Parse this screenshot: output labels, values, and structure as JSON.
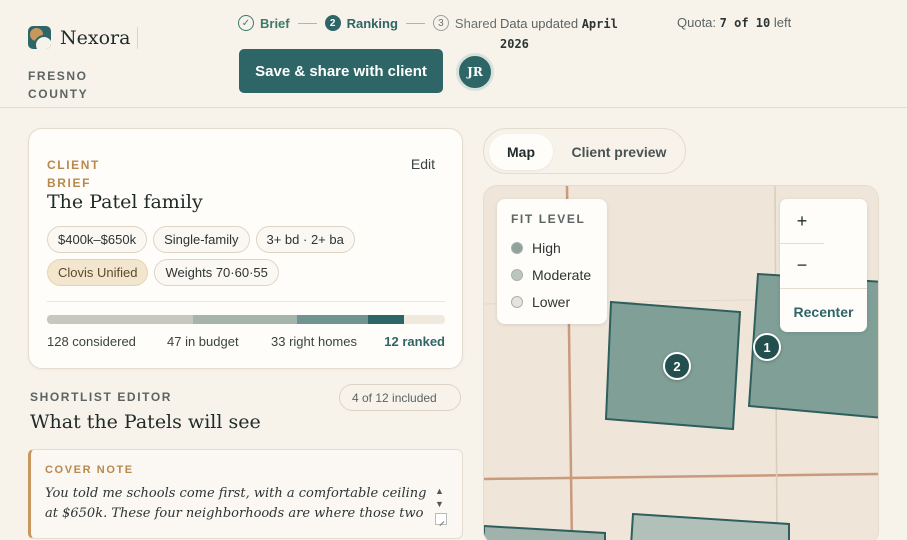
{
  "app": {
    "name": "Nexora",
    "region": "FRESNO COUNTY",
    "avatar_initials": "JR",
    "save_button": "Save & share with client"
  },
  "steps": [
    {
      "num": "✓",
      "label": "Brief",
      "state": "done"
    },
    {
      "num": "2",
      "label": "Ranking",
      "state": "active"
    },
    {
      "num": "3",
      "label": "Shared",
      "state": "todo"
    }
  ],
  "updated": {
    "prefix": "Data updated",
    "value": "April 2026"
  },
  "quota": {
    "prefix": "Quota:",
    "value": "7 of 10",
    "suffix": "left"
  },
  "brief": {
    "eyebrow": "CLIENT BRIEF",
    "edit_label": "Edit",
    "client_name": "The Patel family",
    "chips": [
      {
        "label": "$400k–$650k",
        "highlight": false
      },
      {
        "label": "Single-family",
        "highlight": false
      },
      {
        "label": "3+ bd · 2+ ba",
        "highlight": false
      },
      {
        "label": "Clovis Unified",
        "highlight": true
      },
      {
        "label": "Weights 70·60·55",
        "highlight": false
      }
    ],
    "funnel": [
      {
        "label": "128 considered",
        "count": 128,
        "color": "#c9c6c0"
      },
      {
        "label": "47 in budget",
        "count": 47,
        "color": "#a5b4ac"
      },
      {
        "label": "33 right homes",
        "count": 33,
        "color": "#6e9590"
      },
      {
        "label": "12 ranked",
        "count": 12,
        "color": "#2e6566"
      }
    ]
  },
  "shortlist": {
    "eyebrow": "SHORTLIST EDITOR",
    "title": "What the Patels will see",
    "count": "4 of 12 included",
    "cover_eyebrow": "COVER NOTE",
    "cover_text": "You told me schools come first, with a comfortable ceiling at $650k. These four neighborhoods are where those two"
  },
  "map": {
    "tabs": [
      "Map",
      "Client preview"
    ],
    "legend_title": "FIT LEVEL",
    "legend": [
      {
        "label": "High",
        "color": "#8fa39c"
      },
      {
        "label": "Moderate",
        "color": "#bcc6bf"
      },
      {
        "label": "Lower",
        "color": "#e6e3dd"
      }
    ],
    "zoom_in": "+",
    "zoom_out": "−",
    "recenter": "Recenter",
    "pins": [
      "1",
      "2"
    ]
  }
}
